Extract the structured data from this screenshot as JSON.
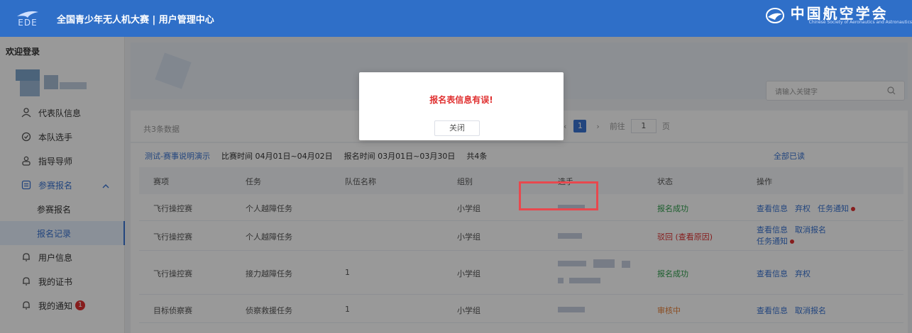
{
  "header": {
    "logo_text": "EDE",
    "title": "全国青少年无人机大赛 | 用户管理中心",
    "brand_name": "中国航空学会",
    "brand_sub": "Chinese Society of Aeronautics and Astronautics"
  },
  "sidebar": {
    "welcome": "欢迎登录",
    "items": [
      {
        "label": "代表队信息",
        "icon": "person-icon"
      },
      {
        "label": "本队选手",
        "icon": "check-circle-icon"
      },
      {
        "label": "指导导师",
        "icon": "group-icon"
      },
      {
        "label": "参赛报名",
        "icon": "form-icon"
      },
      {
        "label": "参赛报名"
      },
      {
        "label": "报名记录"
      },
      {
        "label": "用户信息",
        "icon": "bell-icon"
      },
      {
        "label": "我的证书",
        "icon": "bell-icon"
      },
      {
        "label": "我的通知",
        "icon": "bell-icon",
        "badge": "1"
      }
    ]
  },
  "main": {
    "search_placeholder": "请输入关键字",
    "total_text": "共3条数据",
    "pager": {
      "current": "1",
      "goto_label": "前往",
      "goto_value": "1",
      "page_unit": "页"
    },
    "event": {
      "name": "测试-赛事说明演示",
      "match_time": "比赛时间 04月01日~04月02日",
      "signup_time": "报名时间 03月01日~03月30日",
      "count": "共4条",
      "read_all": "全部已读"
    },
    "table": {
      "headers": [
        "赛项",
        "任务",
        "队伍名称",
        "组别",
        "选手",
        "状态",
        "操作"
      ],
      "rows": [
        {
          "event": "飞行操控赛",
          "task": "个人越障任务",
          "team": "",
          "group": "小学组",
          "status": "报名成功",
          "actions": [
            "查看信息",
            "弃权",
            "任务通知"
          ]
        },
        {
          "event": "飞行操控赛",
          "task": "个人越障任务",
          "team": "",
          "group": "小学组",
          "status": "驳回 (查看原因)",
          "actions": [
            "查看信息",
            "取消报名",
            "任务通知"
          ]
        },
        {
          "event": "飞行操控赛",
          "task": "接力越障任务",
          "team": "1",
          "group": "小学组",
          "status": "报名成功",
          "actions": [
            "查看信息",
            "弃权"
          ]
        },
        {
          "event": "目标侦察赛",
          "task": "侦察救援任务",
          "team": "1",
          "group": "小学组",
          "status": "审核中",
          "actions": [
            "查看信息",
            "取消报名"
          ]
        }
      ]
    }
  },
  "modal": {
    "message": "报名表信息有误!",
    "close_label": "关闭"
  },
  "colors": {
    "header": "#2f6fc8",
    "accent": "#3a74d2",
    "success": "#2e9d4b",
    "error": "#e03131",
    "pending": "#e6813a"
  }
}
